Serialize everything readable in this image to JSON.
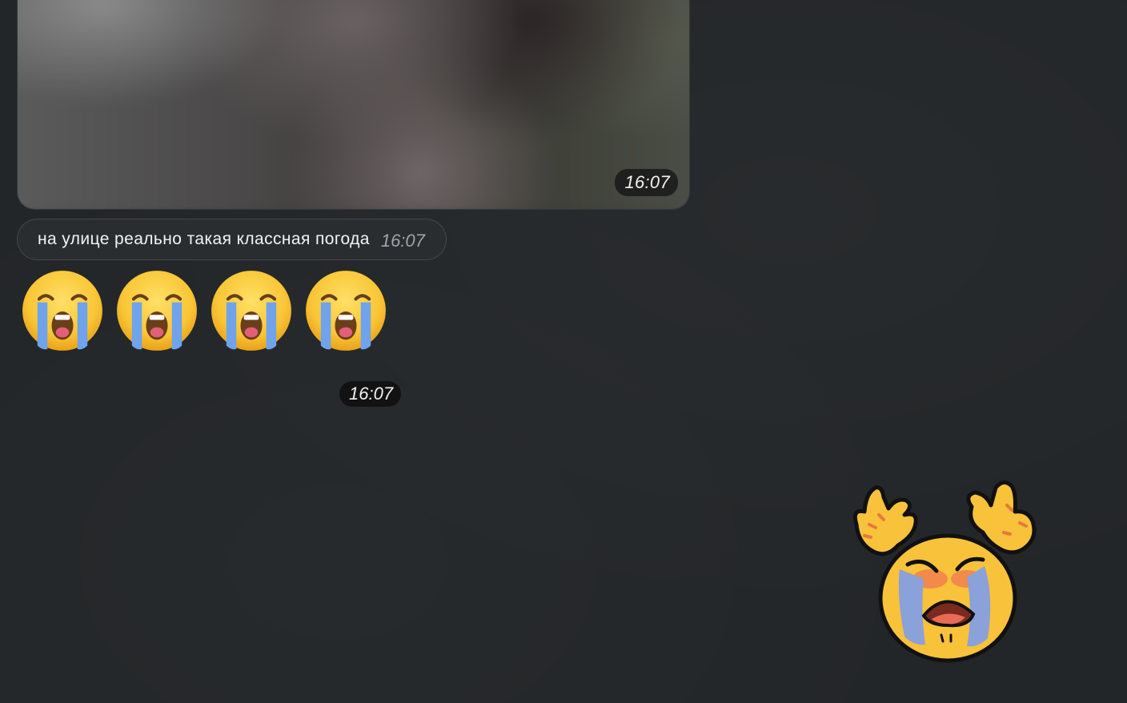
{
  "media_message": {
    "time": "16:07"
  },
  "text_message": {
    "text": "на улице реально такая классная погода",
    "time": "16:07"
  },
  "emoji_message": {
    "emojis": [
      "loudly-crying-face-emoji",
      "loudly-crying-face-emoji",
      "loudly-crying-face-emoji",
      "loudly-crying-face-emoji"
    ],
    "time": "16:07"
  },
  "sticker": {
    "icon": "crying-face-sticker-with-raised-hands"
  },
  "colors": {
    "background": "#232628",
    "bubble": "#2a2d30",
    "time_badge": "#141414",
    "emoji_yellow": "#f7c13b",
    "tears": "#6f9ee8"
  }
}
